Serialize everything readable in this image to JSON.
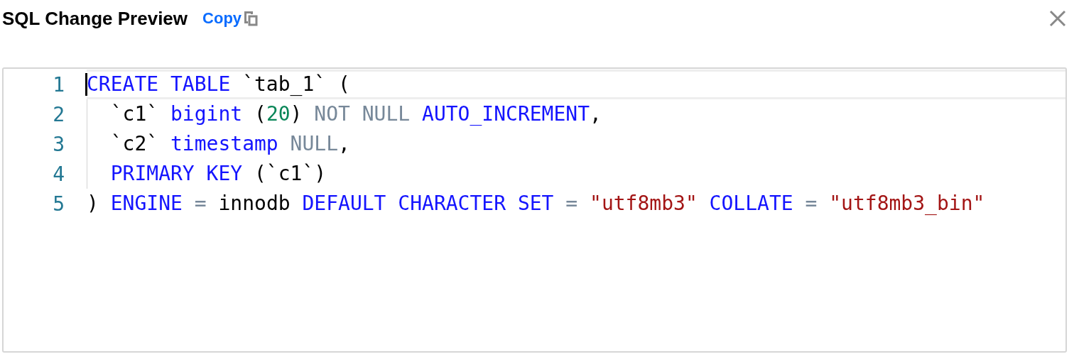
{
  "dialog": {
    "title": "SQL Change Preview",
    "copy_link": "Copy"
  },
  "editor": {
    "lines": [
      {
        "number": "1",
        "active": true,
        "indented": false,
        "tokens": [
          {
            "kind": "keyword",
            "text": "CREATE TABLE"
          },
          {
            "kind": "plain",
            "text": " `tab_1` ("
          }
        ]
      },
      {
        "number": "2",
        "active": false,
        "indented": true,
        "tokens": [
          {
            "kind": "plain",
            "text": "`c1` "
          },
          {
            "kind": "keyword",
            "text": "bigint"
          },
          {
            "kind": "plain",
            "text": " ("
          },
          {
            "kind": "number",
            "text": "20"
          },
          {
            "kind": "plain",
            "text": ") "
          },
          {
            "kind": "muted",
            "text": "NOT NULL"
          },
          {
            "kind": "keyword",
            "text": " AUTO_INCREMENT"
          },
          {
            "kind": "plain",
            "text": ","
          }
        ]
      },
      {
        "number": "3",
        "active": false,
        "indented": true,
        "tokens": [
          {
            "kind": "plain",
            "text": "`c2` "
          },
          {
            "kind": "keyword",
            "text": "timestamp"
          },
          {
            "kind": "muted",
            "text": " NULL"
          },
          {
            "kind": "plain",
            "text": ","
          }
        ]
      },
      {
        "number": "4",
        "active": false,
        "indented": true,
        "tokens": [
          {
            "kind": "keyword",
            "text": "PRIMARY KEY"
          },
          {
            "kind": "plain",
            "text": " (`c1`)"
          }
        ]
      },
      {
        "number": "5",
        "active": false,
        "indented": false,
        "tokens": [
          {
            "kind": "plain",
            "text": ") "
          },
          {
            "kind": "keyword",
            "text": "ENGINE"
          },
          {
            "kind": "operator",
            "text": " ="
          },
          {
            "kind": "plain",
            "text": " innodb "
          },
          {
            "kind": "keyword",
            "text": "DEFAULT CHARACTER SET"
          },
          {
            "kind": "operator",
            "text": " ="
          },
          {
            "kind": "string",
            "text": " \"utf8mb3\""
          },
          {
            "kind": "keyword",
            "text": " COLLATE"
          },
          {
            "kind": "operator",
            "text": " ="
          },
          {
            "kind": "string",
            "text": " \"utf8mb3_bin\""
          }
        ]
      }
    ]
  }
}
